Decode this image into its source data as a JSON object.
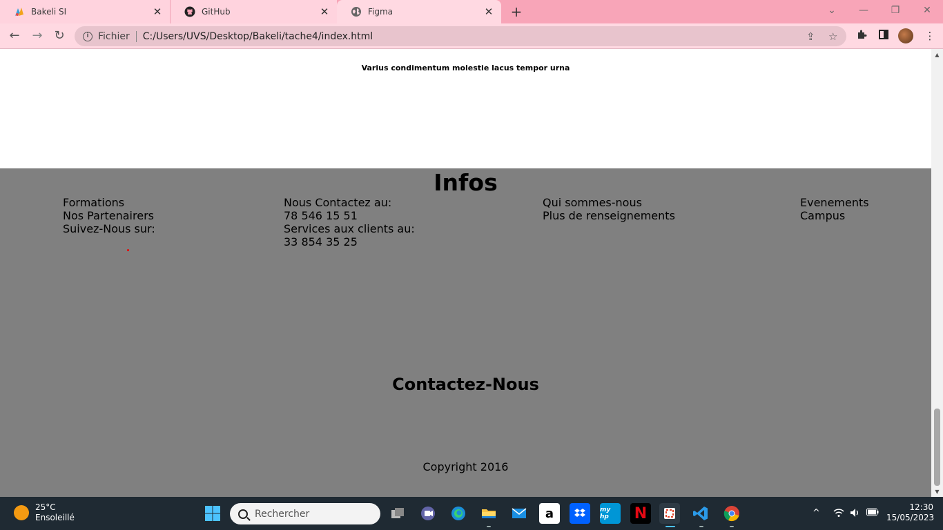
{
  "browser": {
    "tabs": [
      {
        "title": "Bakeli SI",
        "icon": "bakeli-icon"
      },
      {
        "title": "GitHub",
        "icon": "github-icon"
      },
      {
        "title": "Figma",
        "icon": "globe-icon",
        "active": true
      }
    ],
    "address": {
      "scheme_label": "Fichier",
      "url": "C:/Users/UVS/Desktop/Bakeli/tache4/index.html"
    },
    "colors": {
      "tabbar": "#f8a5b8",
      "toolbar": "#ffd9e2"
    }
  },
  "page": {
    "tagline": "Varius condimentum molestie lacus tempor urna",
    "footer": {
      "heading": "Infos",
      "columns": [
        [
          "Formations",
          "Nos Partenairers",
          "Suivez-Nous sur:"
        ],
        [
          "Nous Contactez au:",
          "78 546 15 51",
          "Services aux clients au:",
          "33 854 35 25"
        ],
        [
          "Qui sommes-nous",
          "Plus de renseignements"
        ],
        [
          "Evenements",
          "Campus"
        ]
      ],
      "contact_heading": "Contactez-Nous",
      "copyright": "Copyright 2016",
      "background": "#808080"
    }
  },
  "taskbar": {
    "weather": {
      "temp": "25°C",
      "condition": "Ensoleillé"
    },
    "search_placeholder": "Rechercher",
    "clock": {
      "time": "12:30",
      "date": "15/05/2023"
    },
    "pinned": [
      "windows-start",
      "search",
      "task-view",
      "teams-chat",
      "edge",
      "file-explorer",
      "mail",
      "amazon",
      "dropbox",
      "myhp",
      "netflix",
      "snipping-tool",
      "vscode",
      "chrome"
    ]
  }
}
